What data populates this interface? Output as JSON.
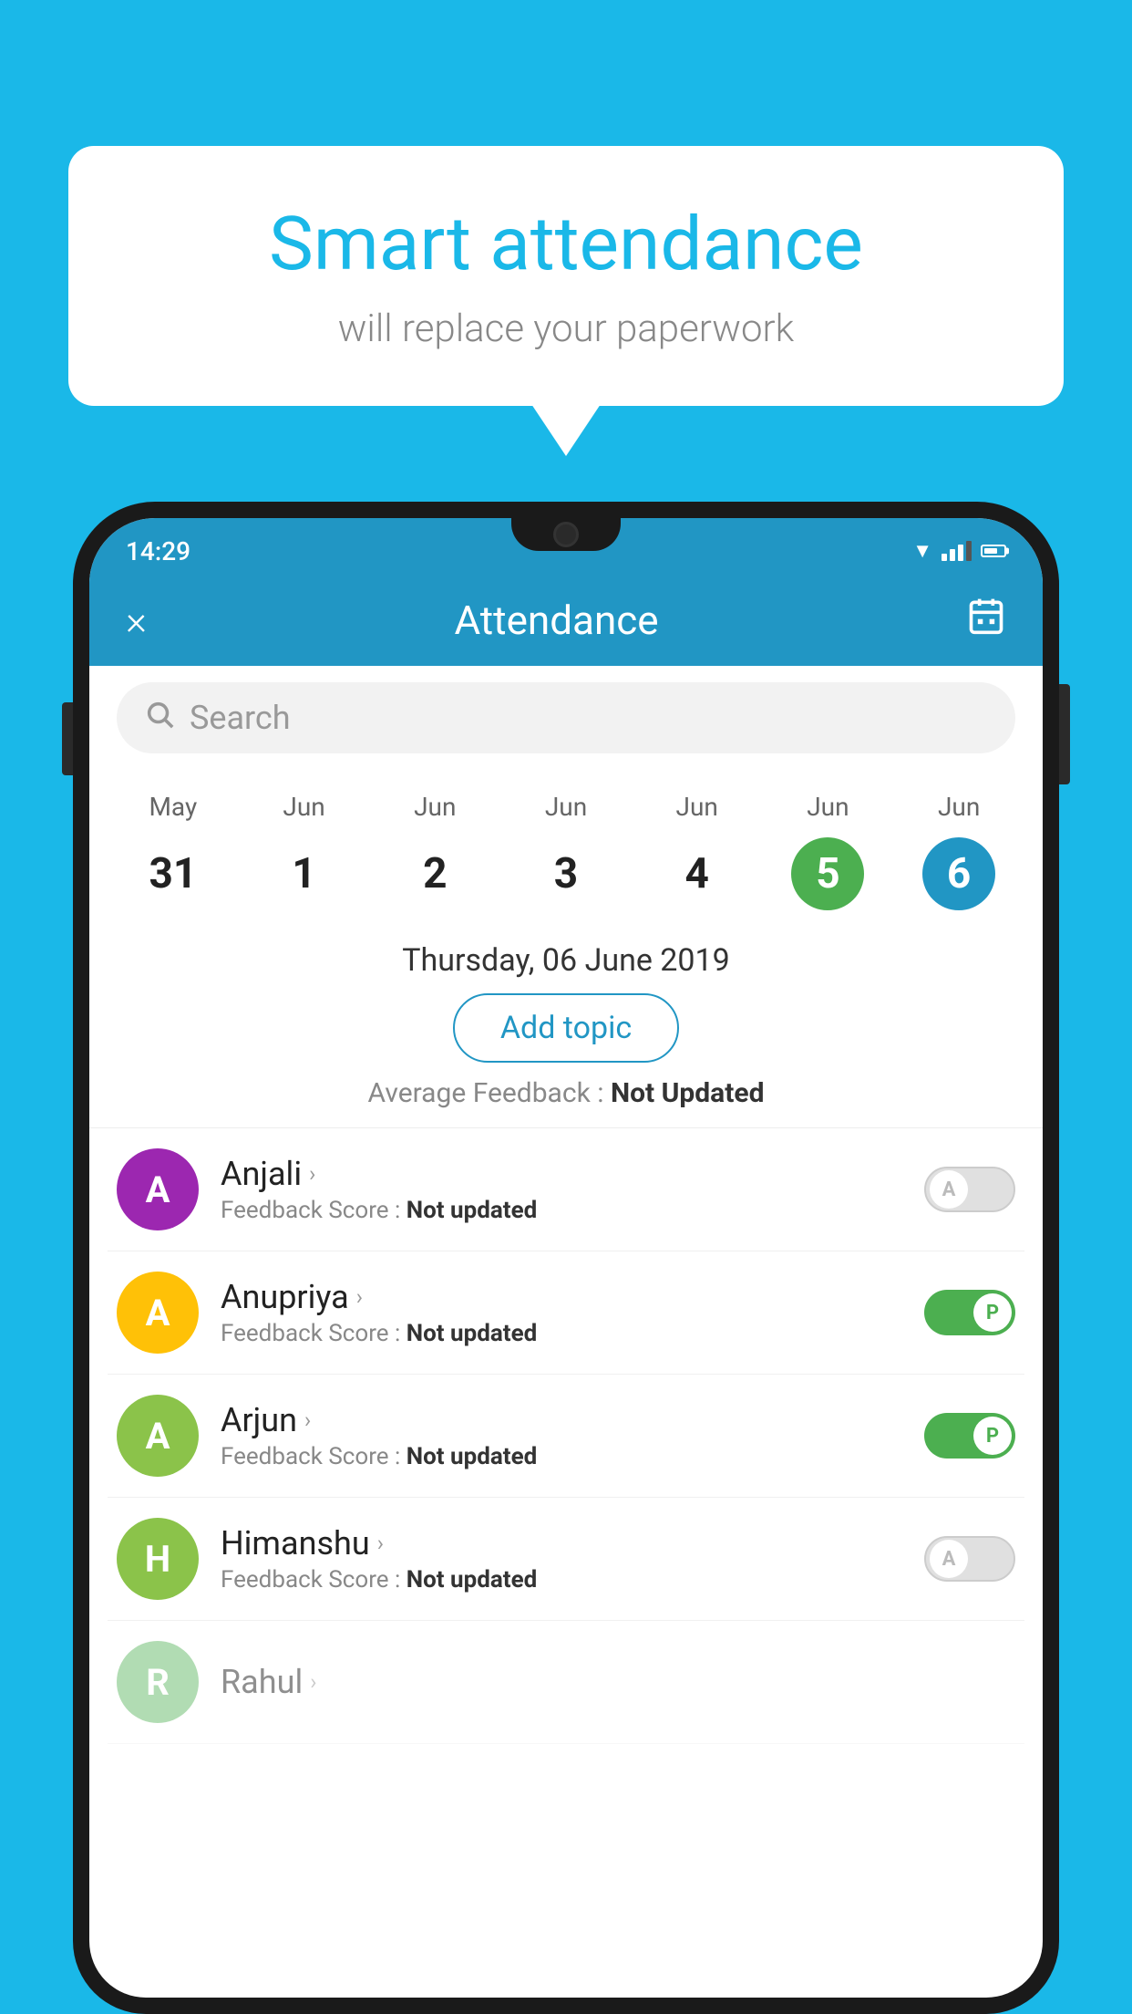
{
  "background": "#1ab8e8",
  "speechBubble": {
    "title": "Smart attendance",
    "subtitle": "will replace your paperwork"
  },
  "statusBar": {
    "time": "14:29",
    "wifiIcon": "▼",
    "batteryLevel": "70"
  },
  "appHeader": {
    "title": "Attendance",
    "closeLabel": "×",
    "calendarIcon": "📅"
  },
  "search": {
    "placeholder": "Search"
  },
  "calendar": {
    "months": [
      "May",
      "Jun",
      "Jun",
      "Jun",
      "Jun",
      "Jun",
      "Jun"
    ],
    "dates": [
      "31",
      "1",
      "2",
      "3",
      "4",
      "5",
      "6"
    ],
    "todayIndex": 5,
    "selectedIndex": 6
  },
  "selectedDate": "Thursday, 06 June 2019",
  "addTopicLabel": "Add topic",
  "averageFeedback": {
    "label": "Average Feedback : ",
    "value": "Not Updated"
  },
  "students": [
    {
      "name": "Anjali",
      "avatarColor": "#9C27B0",
      "avatarLetter": "A",
      "feedbackLabel": "Feedback Score : ",
      "feedbackValue": "Not updated",
      "toggleState": "off",
      "toggleLabel": "A"
    },
    {
      "name": "Anupriya",
      "avatarColor": "#FFC107",
      "avatarLetter": "A",
      "feedbackLabel": "Feedback Score : ",
      "feedbackValue": "Not updated",
      "toggleState": "on",
      "toggleLabel": "P"
    },
    {
      "name": "Arjun",
      "avatarColor": "#8BC34A",
      "avatarLetter": "A",
      "feedbackLabel": "Feedback Score : ",
      "feedbackValue": "Not updated",
      "toggleState": "on",
      "toggleLabel": "P"
    },
    {
      "name": "Himanshu",
      "avatarColor": "#8BC34A",
      "avatarLetter": "H",
      "feedbackLabel": "Feedback Score : ",
      "feedbackValue": "Not updated",
      "toggleState": "off",
      "toggleLabel": "A"
    }
  ]
}
